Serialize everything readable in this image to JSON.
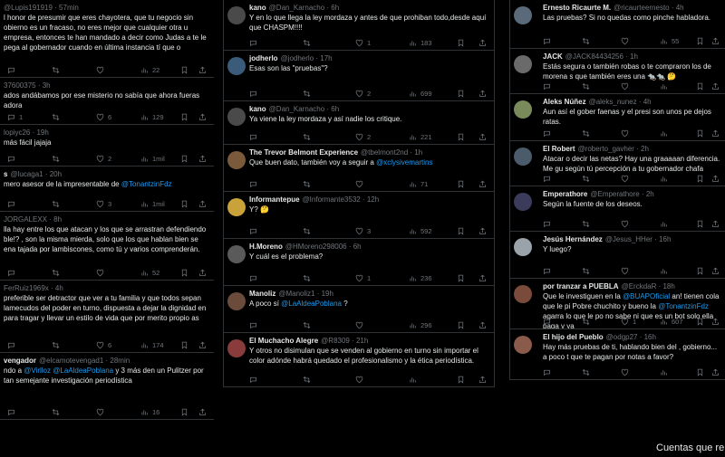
{
  "col1": [
    {
      "head_name": "",
      "head_meta": "@Lupis191919 · 57min",
      "text": "l honor de presumir que eres chayotera, que tu negocio sin obierno es un fracaso, no eres mejor que cualquier otra u empresa, entonces te han mandado a decir como Judas a te le pega al gobernador cuando en última instancia tí que o",
      "reply": "",
      "rt": "",
      "like": "",
      "views": "22"
    },
    {
      "head_name": "",
      "head_meta": "37600375 · 3h",
      "text": "ados andábamos por ese misterio no sabía que ahora fueras adora",
      "reply": "1",
      "rt": "",
      "like": "6",
      "views": "129"
    },
    {
      "head_name": "",
      "head_meta": "lopiyc26 · 19h",
      "text": "más fácil jajaja",
      "reply": "",
      "rt": "",
      "like": "2",
      "views": "1mil"
    },
    {
      "head_name": "s",
      "head_meta": "@lucaga1 · 20h",
      "text": "mero asesor de la impresentable de <@TonantzinFdz>",
      "reply": "",
      "rt": "",
      "like": "3",
      "views": "1mil"
    },
    {
      "head_name": "",
      "head_meta": "JORGALEXX · 8h",
      "text": "lla hay entre los que atacan y los que se arrastran defendiendo ble!? , son la misma mierda, solo que los que hablan bien se ena tajada por lambiscones, como tú y varios comprenderán.",
      "reply": "",
      "rt": "",
      "like": "",
      "views": "52"
    },
    {
      "head_name": "",
      "head_meta": "FerRuiz1969x · 4h",
      "text": "preferible ser detractor que ver a tu familia y que todos sepan lamecudos del poder en turno, dispuesta a dejar la dignidad en para tragar y llevar un estilo de vida que por merito propio as",
      "reply": "",
      "rt": "",
      "like": "6",
      "views": "174"
    },
    {
      "head_name": "vengador",
      "head_meta": "@elcamotevengad1 · 28min",
      "text": "ndo a <@Virlloz> <@LaAldeaPoblana> y 3 más den un Pulitzer por tan semejante investigación periodística",
      "reply": "",
      "rt": "",
      "like": "",
      "views": "16"
    }
  ],
  "col2": [
    {
      "head_name": "kano",
      "head_meta": "@Dan_Karnacho · 6h",
      "text": "Y en lo que llega la ley mordaza y antes de que prohiban todo,desde aquí que CHASPM!!!!",
      "reply": "",
      "rt": "",
      "like": "1",
      "views": "183",
      "avatar": "#4a4a4a"
    },
    {
      "head_name": "jodherlo",
      "head_meta": "@jodherlo · 17h",
      "text": "Esas son las \"pruebas\"?",
      "reply": "",
      "rt": "",
      "like": "2",
      "views": "699",
      "avatar": "#3b5b7a"
    },
    {
      "head_name": "kano",
      "head_meta": "@Dan_Karnacho · 6h",
      "text": "Ya viene la ley mordaza y así nadie los critique.",
      "reply": "",
      "rt": "",
      "like": "2",
      "views": "221",
      "avatar": "#4a4a4a"
    },
    {
      "head_name": "The Trevor Belmont Experience",
      "head_meta": "@tbelmont2nd · 1h",
      "text": "Que buen dato, también voy a seguir a <@xclysivemartins>",
      "reply": "",
      "rt": "",
      "like": "",
      "views": "71",
      "avatar": "#7a5a3b"
    },
    {
      "head_name": "Informantepue",
      "head_meta": "@Informante3532 · 12h",
      "text": "Y? 🤔",
      "reply": "",
      "rt": "",
      "like": "3",
      "views": "592",
      "avatar": "#c9a23a"
    },
    {
      "head_name": "H.Moreno",
      "head_meta": "@HMoreno298006 · 6h",
      "text": "Y cuál es el problema?",
      "reply": "",
      "rt": "",
      "like": "1",
      "views": "236",
      "avatar": "#5a5a5a"
    },
    {
      "head_name": "Manoliz",
      "head_meta": "@Manoliz1 · 19h",
      "text": "A poco sí <@LaAldeaPoblana> ?",
      "reply": "",
      "rt": "",
      "like": "",
      "views": "296",
      "avatar": "#6b4b3b"
    },
    {
      "head_name": "El Muchacho Alegre",
      "head_meta": "@R8309 · 21h",
      "text": "Y otros no disimulan que se venden al gobierno en turno sin importar el color adónde habrá quedado el profesionalismo y la ética periodística.",
      "reply": "",
      "rt": "",
      "like": "",
      "views": "",
      "avatar": "#8a3b3b"
    }
  ],
  "col3": [
    {
      "head_name": "Ernesto Ricaurte M.",
      "head_meta": "@ricaurteernesto · 4h",
      "text": "Las pruebas? Si no quedas como pinche habladora.",
      "reply": "",
      "rt": "",
      "like": "",
      "views": "55",
      "avatar": "#5a6a7a"
    },
    {
      "head_name": "JACK",
      "head_meta": "@JACK84434256 · 1h",
      "text": "Estás segura o también robas o te compraron los de morena s que también eres una 🐀🐀 🤔",
      "reply": "",
      "rt": "",
      "like": "",
      "views": "",
      "avatar": "#6a6a6a"
    },
    {
      "head_name": "Aleks Núñez",
      "head_meta": "@aleks_nunez · 4h",
      "text": "Aun así el gober faenas y el presi son unos pe dejos ratas.",
      "reply": "",
      "rt": "",
      "like": "",
      "views": "",
      "avatar": "#7a8a5a"
    },
    {
      "head_name": "El Robert",
      "head_meta": "@roberto_gavher · 2h",
      "text": "Atacar o decir las netas? Hay una graaaaan diferencia. Me gu según tú percepción a tu gobernador chafa",
      "reply": "",
      "rt": "",
      "like": "",
      "views": "",
      "avatar": "#4b5b6b"
    },
    {
      "head_name": "Emperathore",
      "head_meta": "@Emperathore · 2h",
      "text": "Según la fuente de los deseos.",
      "reply": "",
      "rt": "",
      "like": "",
      "views": "",
      "avatar": "#3b3b5b"
    },
    {
      "head_name": "Jesús Hernández",
      "head_meta": "@Jesus_HHer · 16h",
      "text": "Y luego?",
      "reply": "",
      "rt": "",
      "like": "",
      "views": "",
      "avatar": "#9aa3aa"
    },
    {
      "head_name": "por tranzar a PUEBLA",
      "head_meta": "@ErckdaR · 18h",
      "text": "Que le investiguen en la <@BUAPOficial> an! tienen cola que le pi Pobre chuchito y bueno la <@TonantzinFdz> agarra lo que le po no sabe ni que es un bot solo ella paga y ya",
      "reply": "",
      "rt": "",
      "like": "1",
      "views": "607",
      "avatar": "#7a4b3b"
    },
    {
      "head_name": "El hijo del Pueblo",
      "head_meta": "@odgp27 · 16h",
      "text": "Hay más pruebas de ti, hablando bien del , gobierno... a poco t que te pagan por notas a favor?",
      "reply": "",
      "rt": "",
      "like": "",
      "views": "",
      "avatar": "#8a5a4a"
    }
  ],
  "footer": {
    "cuentas": "Cuentas que re"
  }
}
